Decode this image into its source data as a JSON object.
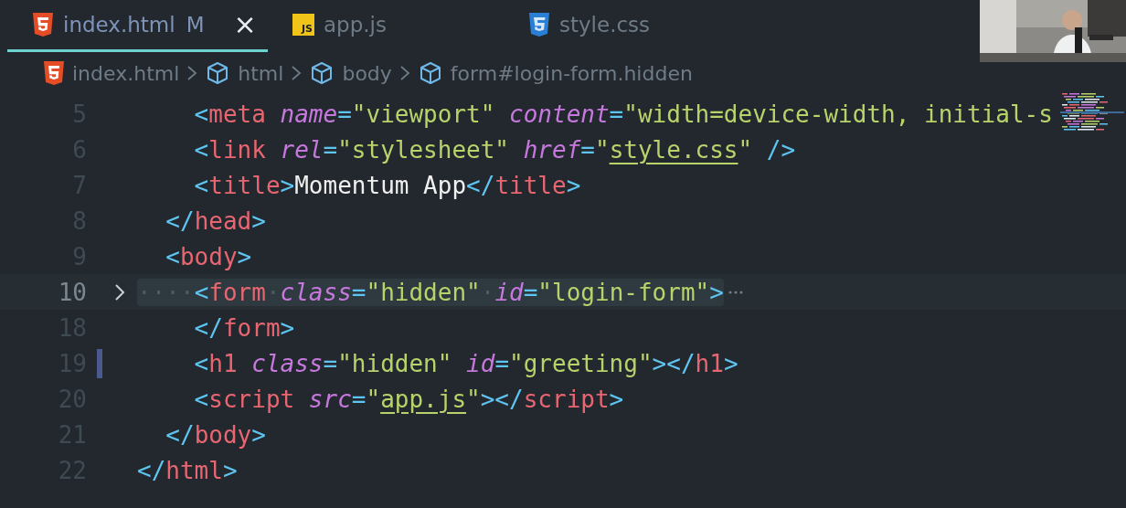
{
  "tabs": [
    {
      "label": "index.html",
      "selected": true,
      "badge": "M",
      "close": "×"
    },
    {
      "label": "app.js",
      "icon_text": "JS",
      "selected": false
    },
    {
      "label": "style.css",
      "selected": false
    }
  ],
  "breadcrumb": [
    {
      "label": "index.html"
    },
    {
      "label": "html"
    },
    {
      "label": "body"
    },
    {
      "label": "form#login-form.hidden"
    }
  ],
  "lines": [
    {
      "number": "5",
      "tokens": [
        {
          "kind": "punct",
          "text": "    <"
        },
        {
          "kind": "tag",
          "text": "meta "
        },
        {
          "kind": "attr",
          "text": "name"
        },
        {
          "kind": "punct",
          "text": "="
        },
        {
          "kind": "string",
          "text": "\"viewport\" "
        },
        {
          "kind": "attr",
          "text": "content"
        },
        {
          "kind": "punct",
          "text": "="
        },
        {
          "kind": "string",
          "text": "\"width=device-width, initial-s"
        }
      ]
    },
    {
      "number": "6",
      "tokens": [
        {
          "kind": "punct",
          "text": "    <"
        },
        {
          "kind": "tag",
          "text": "link "
        },
        {
          "kind": "attr",
          "text": "rel"
        },
        {
          "kind": "punct",
          "text": "="
        },
        {
          "kind": "string",
          "text": "\"stylesheet\" "
        },
        {
          "kind": "attr",
          "text": "href"
        },
        {
          "kind": "punct",
          "text": "="
        },
        {
          "kind": "string",
          "text": "\""
        },
        {
          "kind": "link",
          "text": "style.css"
        },
        {
          "kind": "string",
          "text": "\" "
        },
        {
          "kind": "punct",
          "text": "/>"
        }
      ]
    },
    {
      "number": "7",
      "tokens": [
        {
          "kind": "punct",
          "text": "    <"
        },
        {
          "kind": "tag",
          "text": "title"
        },
        {
          "kind": "punct",
          "text": ">"
        },
        {
          "kind": "text",
          "text": "Momentum App"
        },
        {
          "kind": "punct",
          "text": "</"
        },
        {
          "kind": "tag",
          "text": "title"
        },
        {
          "kind": "punct",
          "text": ">"
        }
      ]
    },
    {
      "number": "8",
      "tokens": [
        {
          "kind": "punct",
          "text": "  </"
        },
        {
          "kind": "tag",
          "text": "head"
        },
        {
          "kind": "punct",
          "text": ">"
        }
      ]
    },
    {
      "number": "9",
      "tokens": [
        {
          "kind": "punct",
          "text": "  <"
        },
        {
          "kind": "tag",
          "text": "body"
        },
        {
          "kind": "punct",
          "text": ">"
        }
      ]
    },
    {
      "number": "10",
      "active": true,
      "folded": true,
      "tokens": [
        {
          "kind": "whitespace",
          "text": "····"
        },
        {
          "kind": "punct",
          "text": "<"
        },
        {
          "kind": "tag",
          "text": "form"
        },
        {
          "kind": "whitespace",
          "text": "·"
        },
        {
          "kind": "attr",
          "text": "class"
        },
        {
          "kind": "punct",
          "text": "="
        },
        {
          "kind": "string",
          "text": "\"hidden\""
        },
        {
          "kind": "whitespace",
          "text": "·"
        },
        {
          "kind": "attr",
          "text": "id"
        },
        {
          "kind": "punct",
          "text": "="
        },
        {
          "kind": "string",
          "text": "\"login-form\""
        },
        {
          "kind": "punct",
          "text": ">"
        }
      ]
    },
    {
      "number": "18",
      "tokens": [
        {
          "kind": "punct",
          "text": "    </"
        },
        {
          "kind": "tag",
          "text": "form"
        },
        {
          "kind": "punct",
          "text": ">"
        }
      ]
    },
    {
      "number": "19",
      "modified": true,
      "tokens": [
        {
          "kind": "punct",
          "text": "    <"
        },
        {
          "kind": "tag",
          "text": "h1 "
        },
        {
          "kind": "attr",
          "text": "class"
        },
        {
          "kind": "punct",
          "text": "="
        },
        {
          "kind": "string",
          "text": "\"hidden\" "
        },
        {
          "kind": "attr",
          "text": "id"
        },
        {
          "kind": "punct",
          "text": "="
        },
        {
          "kind": "string",
          "text": "\"greeting\""
        },
        {
          "kind": "punct",
          "text": "></"
        },
        {
          "kind": "tag",
          "text": "h1"
        },
        {
          "kind": "punct",
          "text": ">"
        }
      ]
    },
    {
      "number": "20",
      "tokens": [
        {
          "kind": "punct",
          "text": "    <"
        },
        {
          "kind": "tag",
          "text": "script "
        },
        {
          "kind": "attr",
          "text": "src"
        },
        {
          "kind": "punct",
          "text": "="
        },
        {
          "kind": "string",
          "text": "\""
        },
        {
          "kind": "link",
          "text": "app.js"
        },
        {
          "kind": "string",
          "text": "\""
        },
        {
          "kind": "punct",
          "text": "></"
        },
        {
          "kind": "tag",
          "text": "script"
        },
        {
          "kind": "punct",
          "text": ">"
        }
      ]
    },
    {
      "number": "21",
      "tokens": [
        {
          "kind": "punct",
          "text": "  </"
        },
        {
          "kind": "tag",
          "text": "body"
        },
        {
          "kind": "punct",
          "text": ">"
        }
      ]
    },
    {
      "number": "22",
      "tokens": [
        {
          "kind": "punct",
          "text": "</"
        },
        {
          "kind": "tag",
          "text": "html"
        },
        {
          "kind": "punct",
          "text": ">"
        }
      ]
    }
  ]
}
